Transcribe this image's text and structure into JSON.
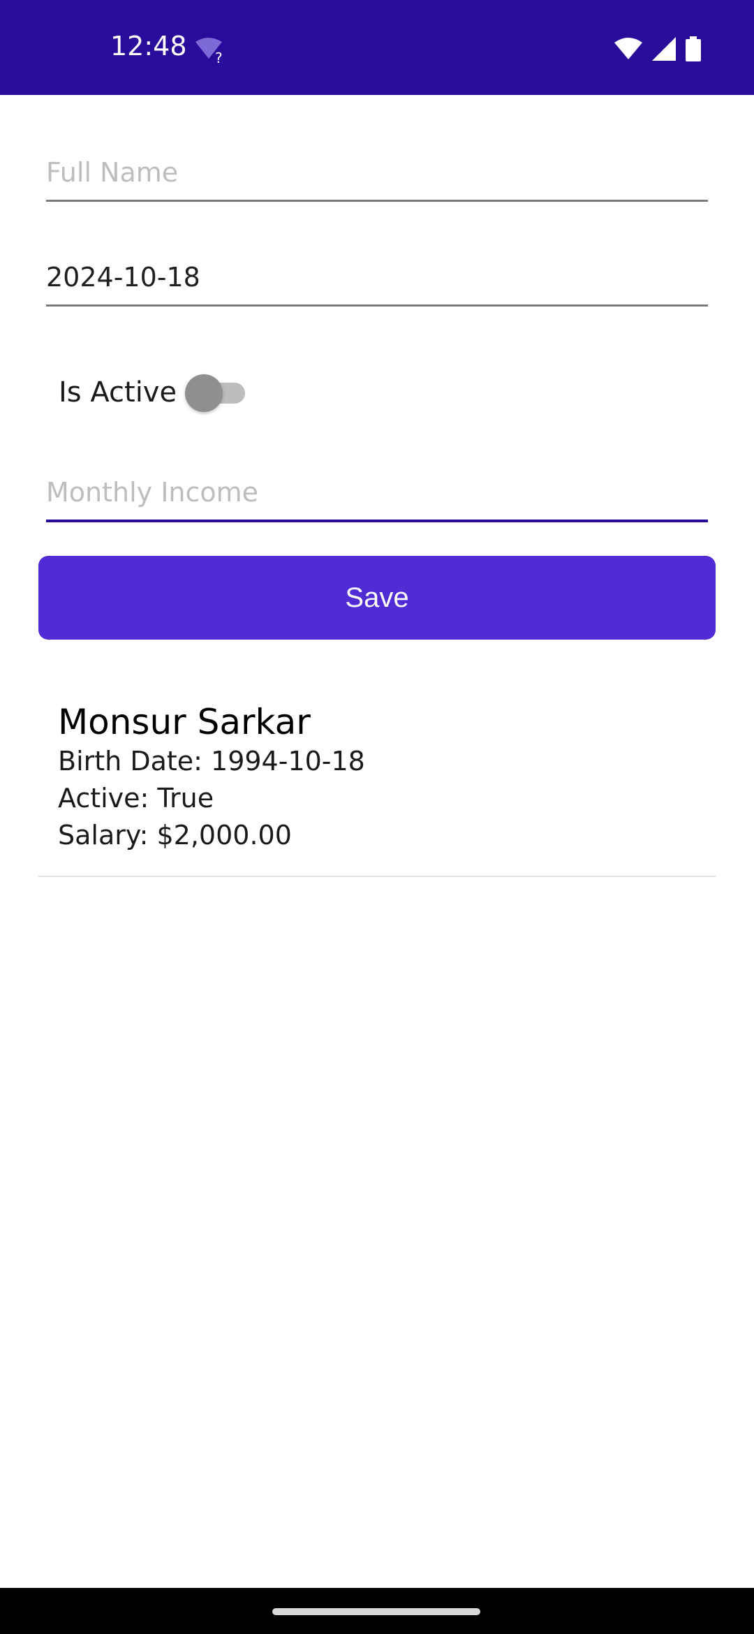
{
  "status_bar": {
    "time": "12:48",
    "wifi_question_glyph": "?",
    "icons": [
      "wifi-question-icon",
      "wifi-icon",
      "signal-icon",
      "battery-icon"
    ]
  },
  "form": {
    "full_name": {
      "value": "",
      "placeholder": "Full Name"
    },
    "birth_date": {
      "value": "2024-10-18"
    },
    "is_active": {
      "label": "Is Active",
      "checked": false
    },
    "monthly_income": {
      "value": "",
      "placeholder": "Monthly Income"
    },
    "save_label": "Save"
  },
  "people": [
    {
      "name": "Monsur Sarkar",
      "birth_date_line": "Birth Date: 1994-10-18",
      "active_line": "Active: True",
      "salary_line": "Salary: $2,000.00"
    }
  ],
  "colors": {
    "status_bar": "#2a0c9b",
    "accent": "#512bd4",
    "focus_underline": "#2a0c9b"
  }
}
